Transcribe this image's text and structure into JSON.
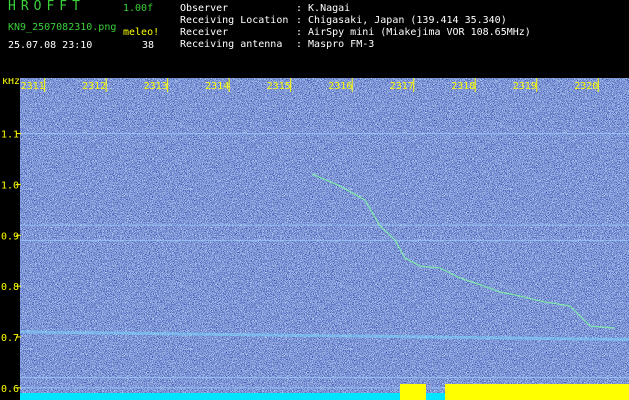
{
  "header": {
    "logo": "HROFFT",
    "version": "1.00f",
    "filename": "KN9_2507082310.png",
    "meleo_label": "meleo!",
    "datetime": "25.07.08 23:10",
    "meleo_count": "38",
    "info": [
      {
        "key": "Observer",
        "value": ": K.Nagai"
      },
      {
        "key": "Receiving Location",
        "value": ": Chigasaki, Japan (139.414 35.340)"
      },
      {
        "key": "Receiver",
        "value": ": AirSpy mini (Miakejima VOR 108.65MHz)"
      },
      {
        "key": "Receiving antenna",
        "value": ": Maspro FM-3"
      }
    ]
  },
  "spectrogram": {
    "y_unit": "kHz",
    "x_ticks": [
      "2311",
      "2312",
      "2313",
      "2314",
      "2315",
      "2316",
      "2317",
      "2318",
      "2319",
      "2320"
    ],
    "y_ticks": [
      "1.1",
      "1.0",
      "0.9",
      "0.8",
      "0.7",
      "0.6"
    ],
    "y_tick_values": [
      1.1,
      1.0,
      0.9,
      0.8,
      0.7,
      0.6
    ],
    "y_range": [
      0.58,
      1.17
    ],
    "x_range": [
      2310.6,
      2320.5
    ],
    "carrier_lines_khz": [
      1.1,
      0.92,
      0.89,
      0.62,
      0.6
    ],
    "colors": {
      "background": "#1a2a9a",
      "tick": "#ffff00",
      "carrier": "#a0d0ff",
      "signal_bar": "#00e5ff",
      "burst_bar": "#ffff00"
    }
  }
}
